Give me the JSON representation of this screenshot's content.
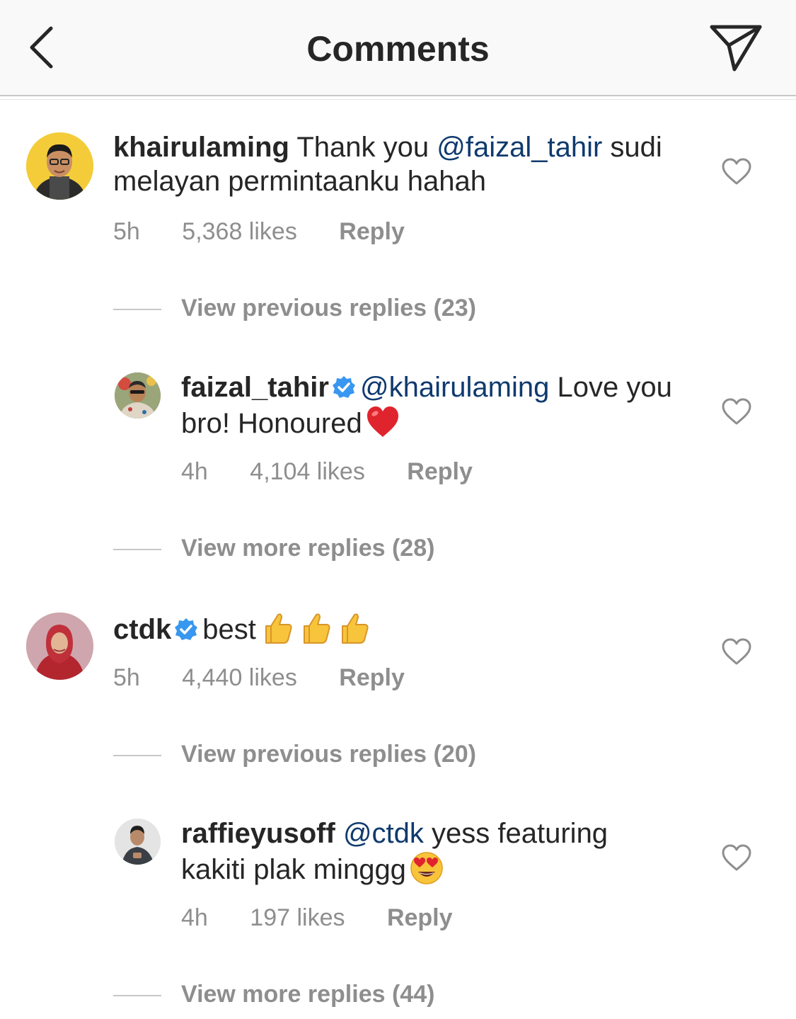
{
  "header": {
    "title": "Comments",
    "back_icon": "chevron-left-icon",
    "send_icon": "paper-plane-icon"
  },
  "comments": [
    {
      "username": "khairulaming",
      "verified": false,
      "text_before": "Thank you",
      "mention": "@faizal_tahir",
      "text_after": "sudi melayan permintaanku hahah",
      "time": "5h",
      "likes": "5,368 likes",
      "reply": "Reply",
      "view_replies": "View previous replies (23)",
      "reply_comment": {
        "username": "faizal_tahir",
        "verified": true,
        "mention": "@khairulaming",
        "text_after": "Love you bro! Honoured",
        "emoji": "red-heart-emoji",
        "time": "4h",
        "likes": "4,104 likes",
        "reply": "Reply",
        "view_replies": "View more replies (28)"
      }
    },
    {
      "username": "ctdk",
      "verified": true,
      "text_after": "best",
      "emoji": "thumbs-up-emoji",
      "time": "5h",
      "likes": "4,440 likes",
      "reply": "Reply",
      "view_replies": "View previous replies (20)",
      "reply_comment": {
        "username": "raffieyusoff",
        "verified": false,
        "mention": "@ctdk",
        "text_after": "yess featuring kakiti plak minggg",
        "emoji": "heart-eyes-emoji",
        "time": "4h",
        "likes": "197 likes",
        "reply": "Reply",
        "view_replies": "View more replies (44)"
      }
    }
  ],
  "colors": {
    "mention": "#0f3a6e",
    "meta": "#8e8e8e",
    "verified": "#3897f0",
    "text": "#262626"
  }
}
